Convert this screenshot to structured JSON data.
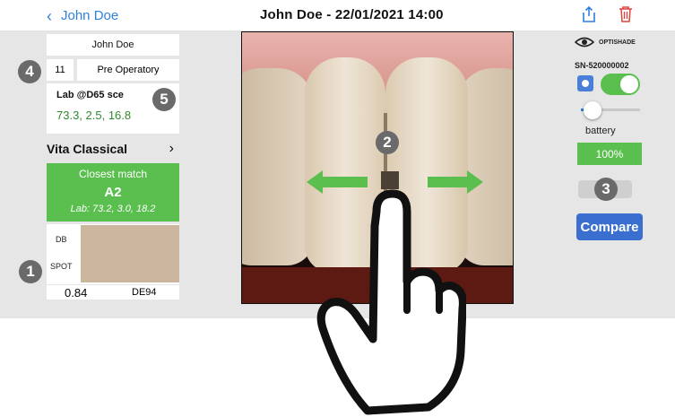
{
  "header": {
    "back_label": "John Doe",
    "title": "John Doe  - 22/01/2021 14:00"
  },
  "left": {
    "patient_name": "John Doe",
    "tooth_number": "11",
    "phase": "Pre Operatory",
    "lab_title": "Lab @D65 sce",
    "lab_values": "73.3, 2.5, 16.8",
    "shade_guide": "Vita Classical",
    "match_label": "Closest match",
    "match_shade": "A2",
    "match_lab": "Lab: 73.2, 3.0, 18.2",
    "db_label": "DB",
    "spot_label": "SPOT",
    "de_value": "0.84",
    "de_unit": "DE94"
  },
  "right": {
    "brand": "OPTISHADE",
    "serial": "SN-520000002",
    "toggle_on": true,
    "battery_label": "battery",
    "battery_value": "100%",
    "compare_label": "Compare"
  },
  "badges": [
    "1",
    "2",
    "3",
    "4",
    "5"
  ],
  "colors": {
    "accent_blue": "#2f7fe0",
    "green": "#5bbf4f",
    "badge_gray": "#6a6a6a",
    "swatch": "#cdb69f"
  }
}
